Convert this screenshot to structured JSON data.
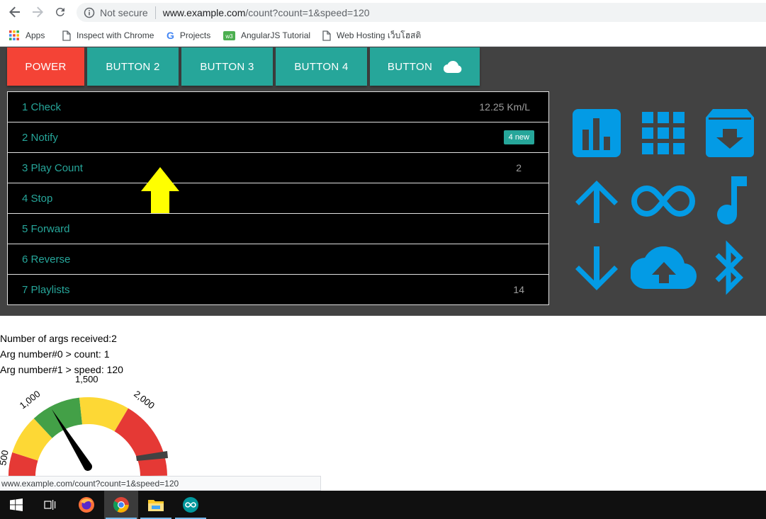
{
  "browser": {
    "security_label": "Not secure",
    "url_host": "www.example.com",
    "url_path": "/count?count=1&speed=120"
  },
  "bookmarks": [
    {
      "label": "Apps",
      "icon": "apps-grid-icon"
    },
    {
      "label": "Inspect with Chrome",
      "icon": "page-icon"
    },
    {
      "label": "Projects",
      "icon": "google-g-icon"
    },
    {
      "label": "AngularJS Tutorial",
      "icon": "w3-icon"
    },
    {
      "label": "Web Hosting เว็บโฮสติ",
      "icon": "page-icon"
    }
  ],
  "tabs": [
    {
      "label": "POWER",
      "color": "#f44336"
    },
    {
      "label": "BUTTON 2",
      "color": "#26a69a"
    },
    {
      "label": "BUTTON 3",
      "color": "#26a69a"
    },
    {
      "label": "BUTTON 4",
      "color": "#26a69a"
    },
    {
      "label": "BUTTON",
      "color": "#26a69a",
      "icon": "cloud-icon"
    }
  ],
  "list": [
    {
      "label": "1 Check",
      "meta": "12.25 Km/L"
    },
    {
      "label": "2 Notify",
      "badge": "4 new"
    },
    {
      "label": "3 Play Count",
      "meta": "2"
    },
    {
      "label": "4 Stop",
      "meta": ""
    },
    {
      "label": "5 Forward",
      "meta": ""
    },
    {
      "label": "6 Reverse",
      "meta": ""
    },
    {
      "label": "7 Playlists",
      "meta": "14"
    }
  ],
  "icon_grid": [
    "bar-chart-icon",
    "grid-apps-icon",
    "archive-download-icon",
    "arrow-up-icon",
    "infinity-icon",
    "music-note-icon",
    "arrow-down-icon",
    "cloud-upload-icon",
    "bluetooth-icon"
  ],
  "colors": {
    "accent": "#26a69a",
    "power": "#f44336",
    "icon_blue": "#039be5",
    "panel_bg": "#424242",
    "annotation_arrow": "#ffff00"
  },
  "content": {
    "args_count": "Number of args received:2",
    "arg0": "Arg number#0 > count: 1",
    "arg1": "Arg number#1 > speed: 120"
  },
  "gauge": {
    "tick_labels": [
      "500",
      "1,000",
      "1,500",
      "2,000"
    ],
    "value": 1200
  },
  "status_url": "www.example.com/count?count=1&speed=120",
  "taskbar": [
    {
      "name": "windows-start-icon"
    },
    {
      "name": "task-view-icon"
    },
    {
      "name": "firefox-icon"
    },
    {
      "name": "chrome-icon",
      "active": true
    },
    {
      "name": "file-explorer-icon"
    },
    {
      "name": "arduino-icon"
    }
  ]
}
